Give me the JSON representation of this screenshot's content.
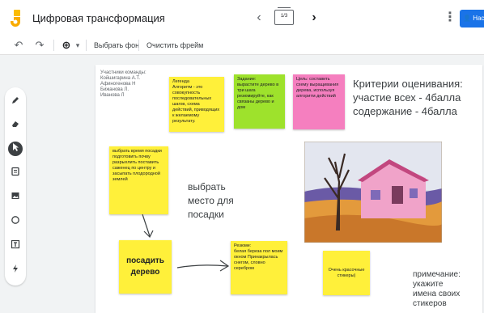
{
  "header": {
    "title": "Цифровая трансформация",
    "frame_indicator": "1/3",
    "share_label": "Настройки доступа"
  },
  "toolbar": {
    "set_background": "Выбрать фон",
    "clear_frame": "Очистить фрейм"
  },
  "tools": [
    {
      "icon": "pen-icon"
    },
    {
      "icon": "eraser-icon"
    },
    {
      "icon": "select-pointer-icon"
    },
    {
      "icon": "sticky-note-icon"
    },
    {
      "icon": "image-icon"
    },
    {
      "icon": "circle-shape-icon"
    },
    {
      "icon": "text-box-icon"
    },
    {
      "icon": "laser-icon"
    }
  ],
  "canvas": {
    "team_text": "Участники команды:\nКойшигарина А.Т.\nАфиногенова Н\nБижанова Л.\nИванова Л",
    "criteria_text": "Критерии оценивания:\nучастие всех - 4балла\nсодержание - 4балла",
    "choose_text": "выбрать\nместо для\nпосадки",
    "remark_text": "примечание:\nукажите\nимена своих\nстикеров",
    "notes": {
      "legend": "Легенда\nАлгоритм - это совокупность последовательных шагов, схема действий, приводящих к желаемому результату.",
      "task": "Задание:\nвырастите дерево в три шага резюмируйте, как связаны дерево и дом",
      "goal": "Цель: составить схему выращивания дерева, используя алгоритм действий",
      "choose_time": "выбрать время посадки подготовить почву разрыхлить поставить саженец по центру и засыпать плодородной землей",
      "plant": "посадить дерево",
      "summary": "Резюме:\nбелая береза пол моим окном Принакрылась снегом, словно серебром",
      "stickers": "Очень красочные стикеры)"
    }
  },
  "colors": {
    "yellow_note": "#fff03a",
    "green_note": "#9ee22c",
    "pink_note": "#f57fbf",
    "accent": "#1a73e8",
    "logo": "#fbbc04"
  }
}
